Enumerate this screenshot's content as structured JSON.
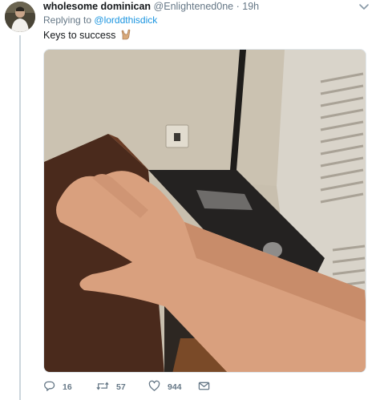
{
  "tweet": {
    "display_name": "wholesome dominican",
    "handle": "@Enlightened0ne",
    "separator": "·",
    "time": "19h",
    "replying_prefix": "Replying to",
    "replying_mention": "@lorddthisdick",
    "text": "Keys to success",
    "emoji": "sign-of-the-horns-hand-emoji"
  },
  "actions": {
    "reply_count": "16",
    "retweet_count": "57",
    "like_count": "944"
  },
  "icons": {
    "caret": "chevron-down-icon",
    "reply": "reply-icon",
    "retweet": "retweet-icon",
    "like": "heart-icon",
    "dm": "envelope-icon"
  },
  "colors": {
    "link": "#1b95e0",
    "muted": "#657786",
    "thread_line": "#ccd6dd"
  }
}
